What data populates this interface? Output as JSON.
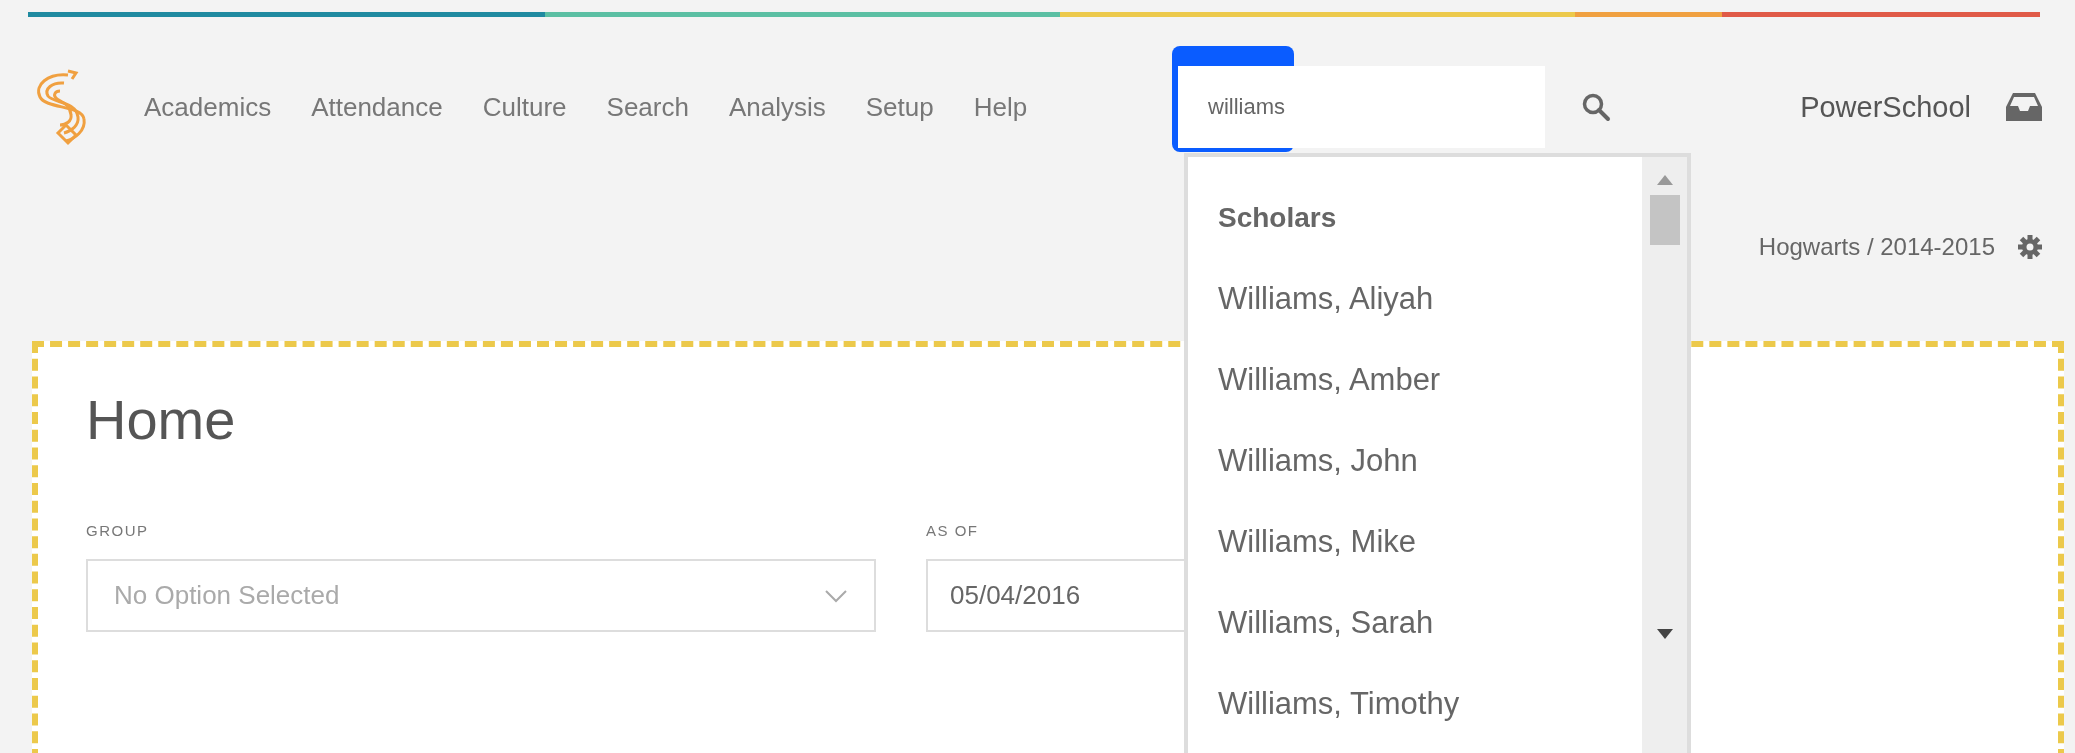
{
  "nav": {
    "items": [
      "Academics",
      "Attendance",
      "Culture",
      "Search",
      "Analysis",
      "Setup",
      "Help"
    ]
  },
  "search": {
    "value": "williams",
    "results": {
      "heading": "Scholars",
      "items": [
        "Williams, Aliyah",
        "Williams, Amber",
        "Williams, John",
        "Williams, Mike",
        "Williams, Sarah",
        "Williams, Timothy"
      ]
    }
  },
  "brand": "PowerSchool",
  "context": "Hogwarts / 2014-2015",
  "page": {
    "title": "Home",
    "filters": [
      {
        "kind": "select",
        "label": "GROUP",
        "placeholder": "No Option Selected"
      },
      {
        "kind": "date",
        "label": "AS OF",
        "value": "05/04/2016"
      }
    ]
  }
}
